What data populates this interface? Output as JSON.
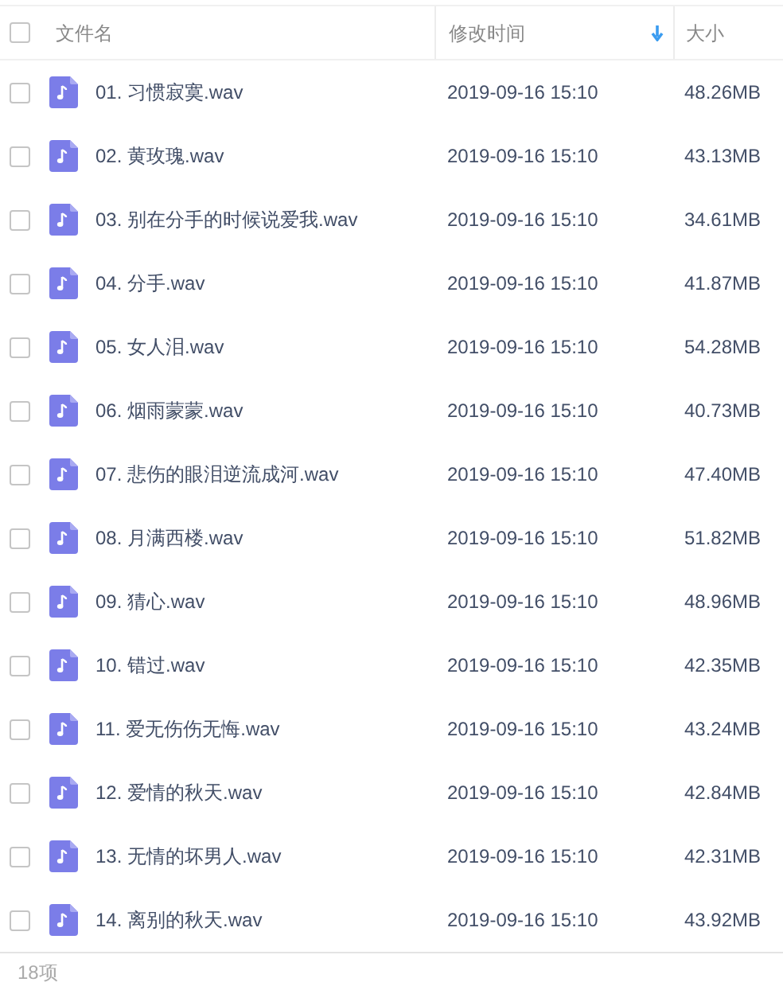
{
  "header": {
    "select_all": {
      "checked": false
    },
    "columns": [
      {
        "label": "文件名",
        "sorted": false
      },
      {
        "label": "修改时间",
        "sorted": true
      },
      {
        "label": "大小",
        "sorted": false
      }
    ]
  },
  "rows": [
    {
      "name": "01. 习惯寂寞.wav",
      "modified": "2019-09-16 15:10",
      "size": "48.26MB",
      "checked": false
    },
    {
      "name": "02. 黄玫瑰.wav",
      "modified": "2019-09-16 15:10",
      "size": "43.13MB",
      "checked": false
    },
    {
      "name": "03. 别在分手的时候说爱我.wav",
      "modified": "2019-09-16 15:10",
      "size": "34.61MB",
      "checked": false
    },
    {
      "name": "04. 分手.wav",
      "modified": "2019-09-16 15:10",
      "size": "41.87MB",
      "checked": false
    },
    {
      "name": "05. 女人泪.wav",
      "modified": "2019-09-16 15:10",
      "size": "54.28MB",
      "checked": false
    },
    {
      "name": "06. 烟雨蒙蒙.wav",
      "modified": "2019-09-16 15:10",
      "size": "40.73MB",
      "checked": false
    },
    {
      "name": "07. 悲伤的眼泪逆流成河.wav",
      "modified": "2019-09-16 15:10",
      "size": "47.40MB",
      "checked": false
    },
    {
      "name": "08. 月满西楼.wav",
      "modified": "2019-09-16 15:10",
      "size": "51.82MB",
      "checked": false
    },
    {
      "name": "09. 猜心.wav",
      "modified": "2019-09-16 15:10",
      "size": "48.96MB",
      "checked": false
    },
    {
      "name": "10. 错过.wav",
      "modified": "2019-09-16 15:10",
      "size": "42.35MB",
      "checked": false
    },
    {
      "name": "11. 爱无伤伤无悔.wav",
      "modified": "2019-09-16 15:10",
      "size": "43.24MB",
      "checked": false
    },
    {
      "name": "12. 爱情的秋天.wav",
      "modified": "2019-09-16 15:10",
      "size": "42.84MB",
      "checked": false
    },
    {
      "name": "13. 无情的坏男人.wav",
      "modified": "2019-09-16 15:10",
      "size": "42.31MB",
      "checked": false
    },
    {
      "name": "14. 离别的秋天.wav",
      "modified": "2019-09-16 15:10",
      "size": "43.92MB",
      "checked": false
    }
  ],
  "status_bar": {
    "count": "18项"
  }
}
